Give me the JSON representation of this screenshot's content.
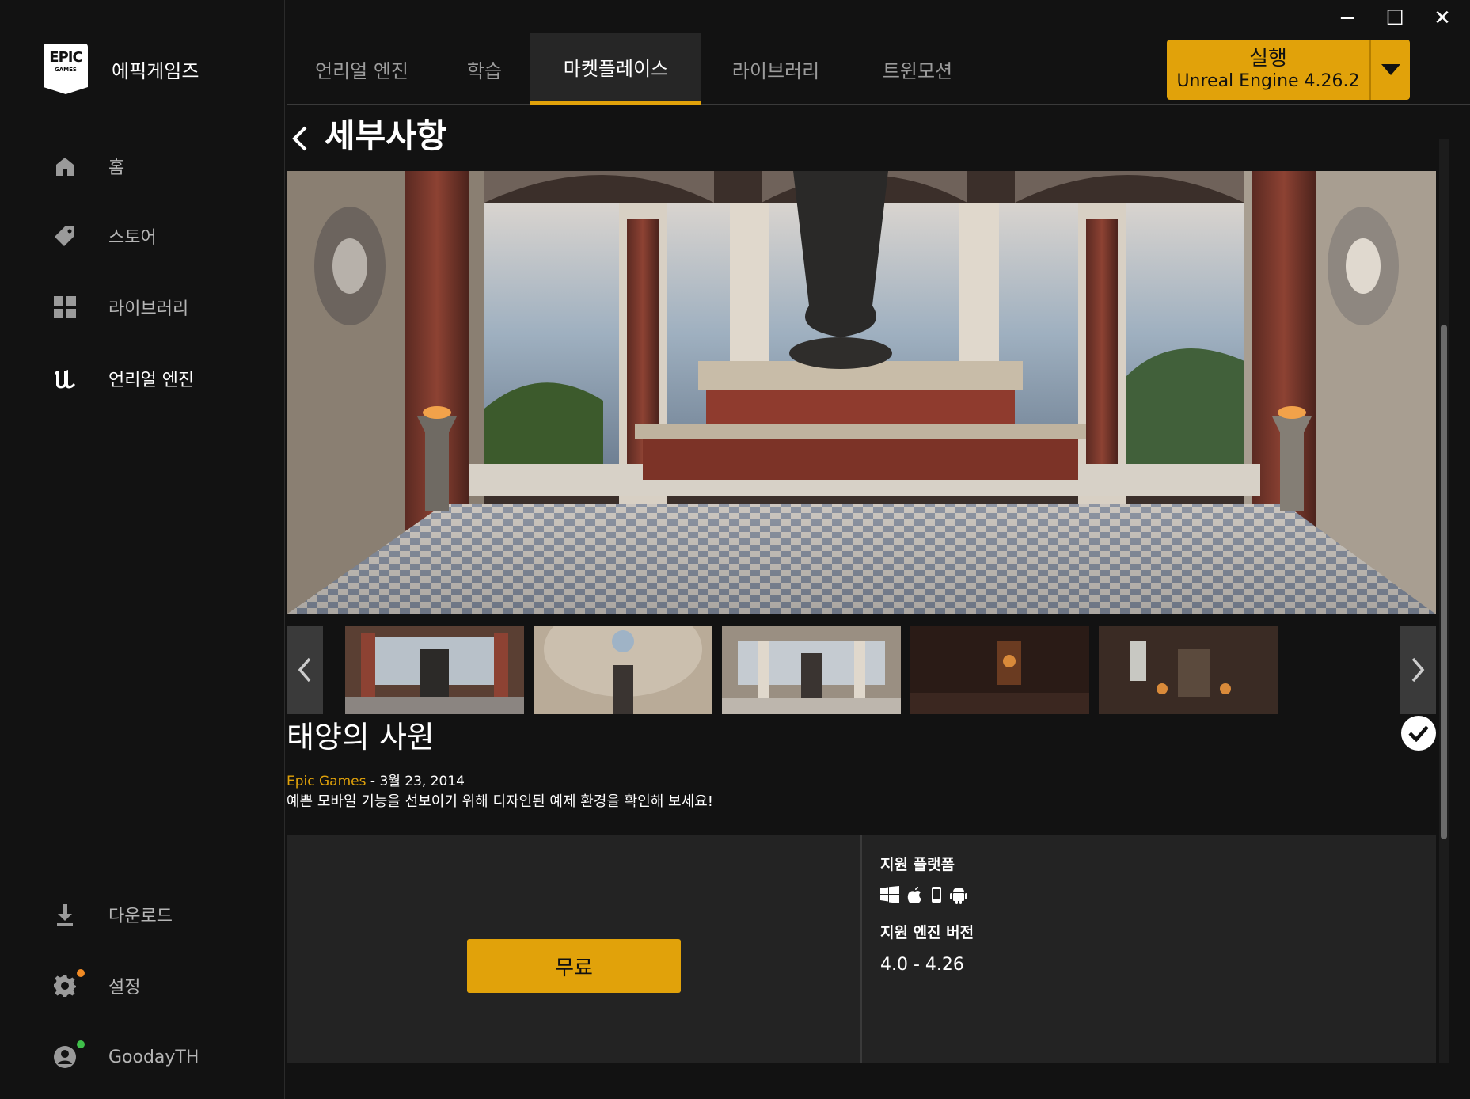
{
  "window": {
    "minimize": "−",
    "maximize": "☐",
    "close": "✕"
  },
  "brand": {
    "logo_line1": "EPIC",
    "logo_line2": "GAMES",
    "name": "에픽게임즈"
  },
  "sidebar": {
    "items": [
      {
        "label": "홈",
        "icon": "home-icon"
      },
      {
        "label": "스토어",
        "icon": "tag-icon"
      },
      {
        "label": "라이브러리",
        "icon": "grid-icon"
      },
      {
        "label": "언리얼 엔진",
        "icon": "unreal-icon",
        "active": true
      }
    ],
    "bottom": [
      {
        "label": "다운로드",
        "icon": "download-icon"
      },
      {
        "label": "설정",
        "icon": "gear-icon",
        "badge_color": "#f08a24"
      },
      {
        "label": "GoodayTH",
        "icon": "user-icon",
        "badge_color": "#3fbf4a"
      }
    ]
  },
  "tabs": [
    {
      "label": "언리얼 엔진"
    },
    {
      "label": "학습"
    },
    {
      "label": "마켓플레이스",
      "active": true
    },
    {
      "label": "라이브러리"
    },
    {
      "label": "트윈모션"
    }
  ],
  "launch": {
    "label": "실행",
    "version": "Unreal Engine 4.26.2"
  },
  "page": {
    "title": "세부사항"
  },
  "asset": {
    "title": "태양의 사원",
    "seller": "Epic Games",
    "separator": " - ",
    "date": "3월 23, 2014",
    "description": "예쁜 모바일 기능을 선보이기 위해 디자인된 예제 환경을 확인해 보세요!",
    "price_button": "무료",
    "platforms_heading": "지원 플랫폼",
    "platforms": [
      "windows-icon",
      "apple-icon",
      "mobile-icon",
      "android-icon"
    ],
    "engine_heading": "지원 엔진 버전",
    "engine_versions": "4.0 - 4.26"
  },
  "colors": {
    "accent": "#e1a20a",
    "background": "#121212",
    "panel": "#232323"
  }
}
